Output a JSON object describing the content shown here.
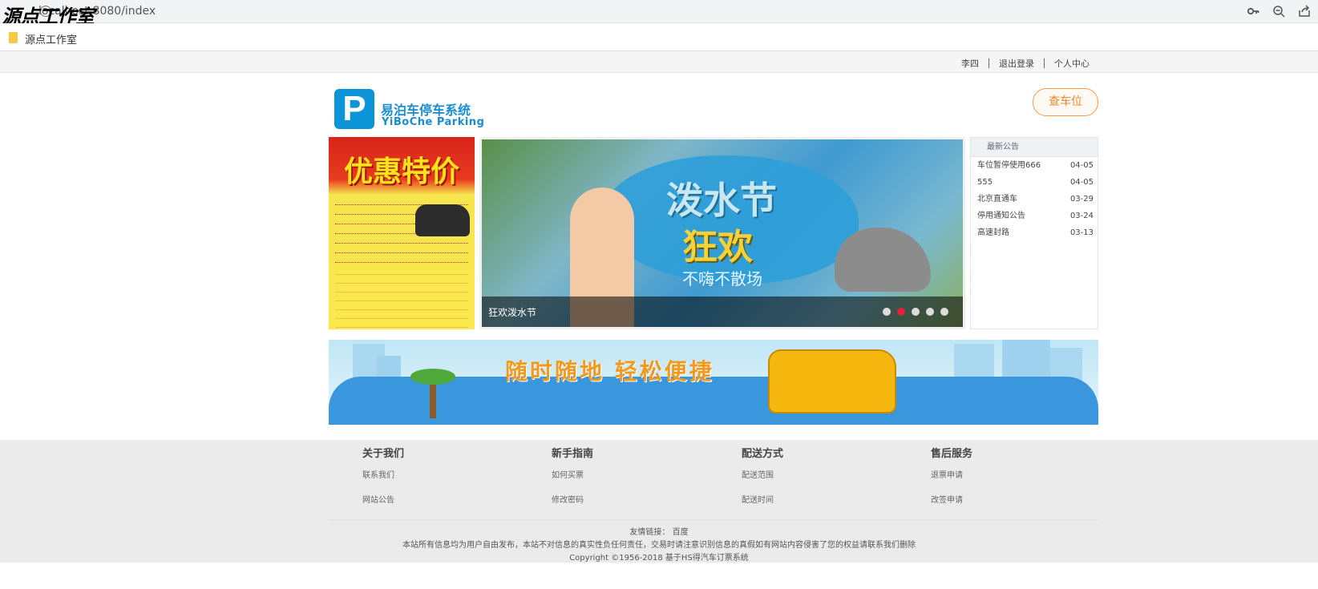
{
  "browser": {
    "watermark": "源点工作室",
    "url": "localhost:8080/index",
    "icons": [
      "key-icon",
      "zoom-icon",
      "share-icon"
    ],
    "bookmark_label": "源点工作室"
  },
  "topbar": {
    "user": "李四",
    "logout": "退出登录",
    "profile": "个人中心"
  },
  "header": {
    "logo_letter": "P",
    "logo_cn": "易泊车停车系统",
    "logo_en": "YiBoChe  Parking",
    "find_button": "查车位"
  },
  "poster": {
    "title": "优惠特价"
  },
  "carousel": {
    "title_line1": "泼水节",
    "title_line2": "狂欢",
    "title_line3": "不嗨不散场",
    "caption": "狂欢泼水节",
    "slide_count": 5,
    "active_index": 1
  },
  "notice": {
    "header": "最新公告",
    "items": [
      {
        "title": "车位暂停使用666",
        "date": "04-05"
      },
      {
        "title": "555",
        "date": "04-05"
      },
      {
        "title": "北京直通车",
        "date": "03-29"
      },
      {
        "title": "停用通知公告",
        "date": "03-24"
      },
      {
        "title": "高速封路",
        "date": "03-13"
      }
    ]
  },
  "banner": {
    "text": "随时随地    轻松便捷"
  },
  "footer": {
    "columns": [
      {
        "title": "关于我们",
        "links": [
          "联系我们",
          "网站公告"
        ]
      },
      {
        "title": "新手指南",
        "links": [
          "如何买票",
          "修改密码"
        ]
      },
      {
        "title": "配送方式",
        "links": [
          "配送范围",
          "配送时间"
        ]
      },
      {
        "title": "售后服务",
        "links": [
          "退票申请",
          "改签申请"
        ]
      }
    ],
    "friend_links_label": "友情链接：",
    "friend_link": "百度",
    "disclaimer": "本站所有信息均为用户自由发布，本站不对信息的真实性负任何责任，交易时请注意识别信息的真假如有网站内容侵害了您的权益请联系我们删除",
    "copyright": "Copyright ©1956-2018 基于HS得汽车订票系统"
  },
  "colors": {
    "brand_blue": "#0b95d8",
    "accent_orange": "#f0872a",
    "active_dot": "#e4223a"
  }
}
